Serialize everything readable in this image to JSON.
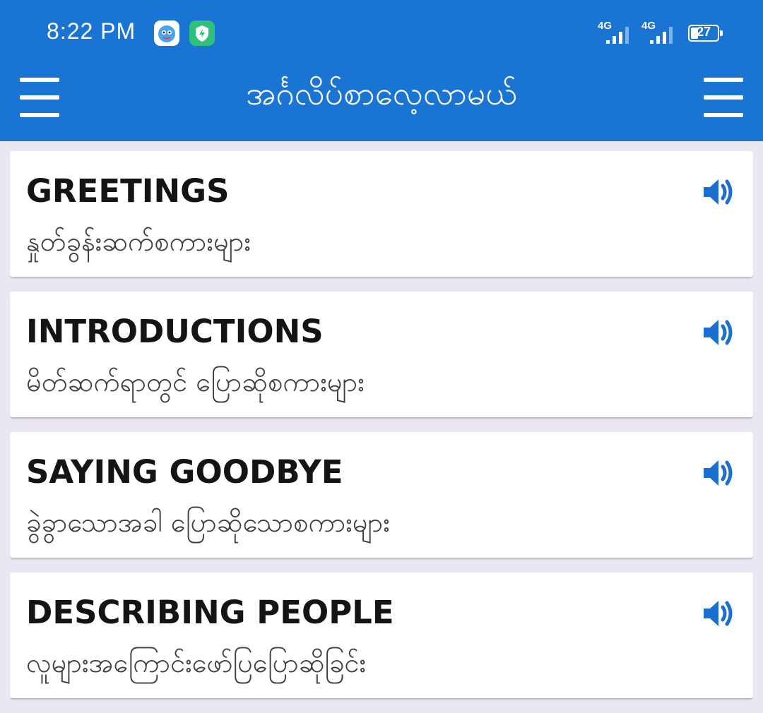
{
  "status_bar": {
    "time": "8:22 PM",
    "network1": "4G",
    "network2": "4G",
    "battery": "27"
  },
  "app_bar": {
    "title": "အင်္ဂလိပ်စာလေ့လာမယ်"
  },
  "lessons": [
    {
      "title": "GREETINGS",
      "subtitle": "နှုတ်ခွန်းဆက်စကားများ"
    },
    {
      "title": "INTRODUCTIONS",
      "subtitle": "မိတ်ဆက်ရာတွင် ပြောဆိုစကားများ"
    },
    {
      "title": "SAYING GOODBYE",
      "subtitle": "ခွဲခွာသောအခါ ပြောဆိုသောစကားများ"
    },
    {
      "title": "DESCRIBING PEOPLE",
      "subtitle": "လူများအကြောင်းဖော်ပြပြောဆိုခြင်း"
    }
  ],
  "colors": {
    "primary": "#1a74d4",
    "background": "#ebe7f2",
    "card": "#ffffff",
    "speaker": "#1a6fd0"
  },
  "icons": {
    "menu": "hamburger-menu-icon",
    "audio": "speaker-icon"
  }
}
